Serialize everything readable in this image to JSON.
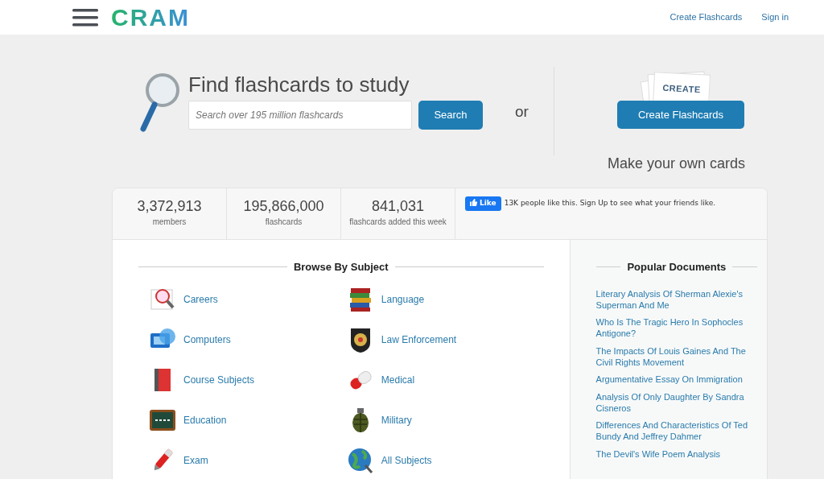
{
  "header": {
    "logo": "CRAM",
    "links": [
      {
        "label": "Create Flashcards"
      },
      {
        "label": "Sign in"
      }
    ]
  },
  "hero": {
    "title": "Find flashcards to study",
    "search": {
      "placeholder": "Search over 195 million flashcards"
    },
    "search_button": "Search",
    "or_text": "or",
    "create_card_label": "CREATE",
    "create_button": "Create Flashcards",
    "tagline": "Make your own cards"
  },
  "stats": [
    {
      "value": "3,372,913",
      "label": "members"
    },
    {
      "value": "195,866,000",
      "label": "flashcards"
    },
    {
      "value": "841,031",
      "label": "flashcards added this week"
    }
  ],
  "facebook": {
    "like_button": "Like",
    "text_before": "13K people like this.",
    "link": "Sign Up",
    "text_after": "to see what your friends like."
  },
  "browse": {
    "title": "Browse By Subject",
    "subjects": [
      {
        "label": "Careers"
      },
      {
        "label": "Language"
      },
      {
        "label": "Computers"
      },
      {
        "label": "Law Enforcement"
      },
      {
        "label": "Course Subjects"
      },
      {
        "label": "Medical"
      },
      {
        "label": "Education"
      },
      {
        "label": "Military"
      },
      {
        "label": "Exam"
      },
      {
        "label": "All Subjects"
      }
    ]
  },
  "popular": {
    "title": "Popular Documents",
    "documents": [
      {
        "title": "Literary Analysis Of Sherman Alexie's Superman And Me"
      },
      {
        "title": "Who Is The Tragic Hero In Sophocles Antigone?"
      },
      {
        "title": "The Impacts Of Louis Gaines And The Civil Rights Movement"
      },
      {
        "title": "Argumentative Essay On Immigration"
      },
      {
        "title": "Analysis Of Only Daughter By Sandra Cisneros"
      },
      {
        "title": "Differences And Characteristics Of Ted Bundy And Jeffrey Dahmer"
      },
      {
        "title": "The Devil's Wife Poem Analysis"
      }
    ]
  }
}
